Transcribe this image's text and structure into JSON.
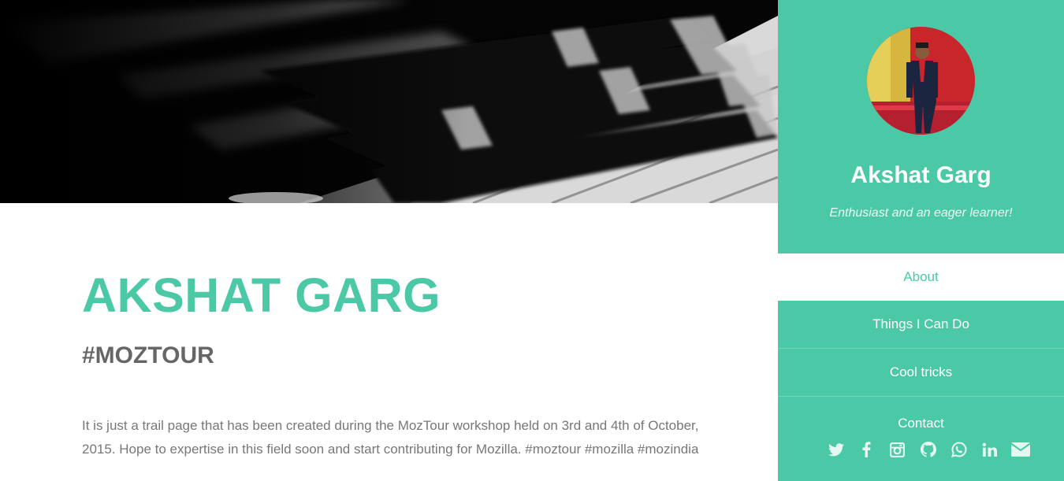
{
  "main": {
    "title": "AKSHAT GARG",
    "subtitle": "#MOZTOUR",
    "body": "It is just a trail page that has been created during the MozTour workshop held on 3rd and 4th of October, 2015. Hope to expertise in this field soon and start contributing for Mozilla. #moztour #mozilla #mozindia"
  },
  "sidebar": {
    "name": "Akshat Garg",
    "tagline": "Enthusiast and an eager learner!",
    "nav": [
      {
        "label": "About",
        "active": true
      },
      {
        "label": "Things I Can Do"
      },
      {
        "label": "Cool tricks"
      }
    ],
    "contact_label": "Contact",
    "social_icons": [
      "twitter-icon",
      "facebook-icon",
      "instagram-icon",
      "github-icon",
      "whatsapp-icon",
      "linkedin-icon",
      "envelope-icon"
    ]
  },
  "colors": {
    "accent": "#4bc9a7",
    "text_gray": "#777777",
    "subtitle_gray": "#666666"
  }
}
